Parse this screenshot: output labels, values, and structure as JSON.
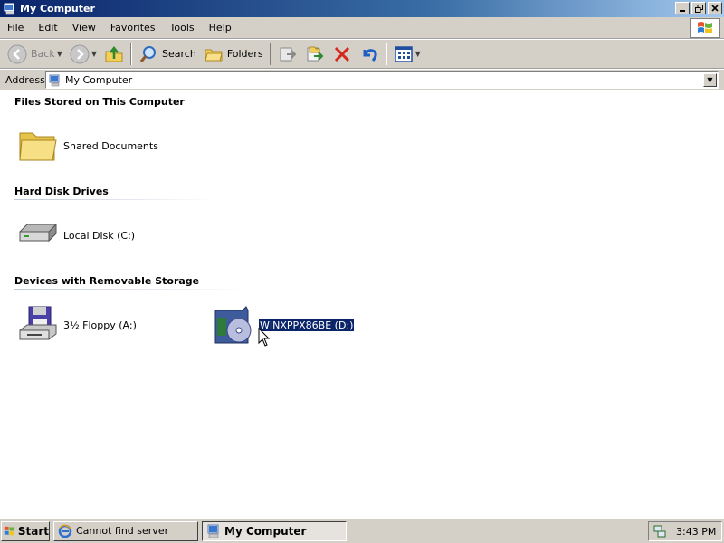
{
  "window": {
    "title": "My Computer"
  },
  "menubar": {
    "items": [
      "File",
      "Edit",
      "View",
      "Favorites",
      "Tools",
      "Help"
    ]
  },
  "toolbar": {
    "back_label": "Back",
    "search_label": "Search",
    "folders_label": "Folders"
  },
  "address": {
    "label": "Address",
    "value": "My Computer"
  },
  "groups": [
    {
      "heading": "Files Stored on This Computer",
      "items": [
        {
          "label": "Shared Documents",
          "icon": "folder-icon"
        }
      ]
    },
    {
      "heading": "Hard Disk Drives",
      "items": [
        {
          "label": "Local Disk (C:)",
          "icon": "hard-disk-icon"
        }
      ]
    },
    {
      "heading": "Devices with Removable Storage",
      "items": [
        {
          "label": "3½ Floppy (A:)",
          "icon": "floppy-drive-icon"
        },
        {
          "label": "WINXPPX86BE (D:)",
          "icon": "cd-drive-icon",
          "selected": true
        }
      ]
    }
  ],
  "taskbar": {
    "start_label": "Start",
    "tasks": [
      {
        "label": "Cannot find server",
        "icon": "ie-icon"
      },
      {
        "label": "My Computer",
        "icon": "my-computer-icon",
        "active": true
      }
    ],
    "clock": "3:43 PM"
  },
  "colors": {
    "title_start": "#0a246a",
    "selection": "#0a246a",
    "chrome": "#d4d0c8"
  }
}
